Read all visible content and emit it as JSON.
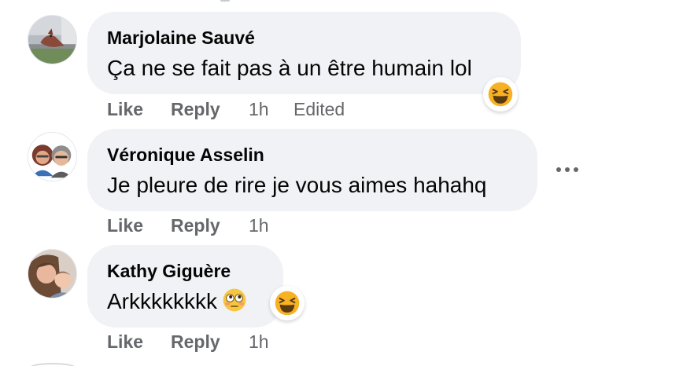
{
  "comments": [
    {
      "author": "Marjolaine Sauvé",
      "text": "Ça ne se fait pas à un être humain lol",
      "avatar": "bird-photo-avatar",
      "reaction": "laughing-face-icon",
      "actions": {
        "like": "Like",
        "reply": "Reply",
        "time": "1h",
        "edited": "Edited"
      }
    },
    {
      "author": "Véronique Asselin",
      "text": "Je pleure de rire je vous aimes hahahq",
      "avatar": "couple-photo-avatar",
      "actions": {
        "like": "Like",
        "reply": "Reply",
        "time": "1h"
      }
    },
    {
      "author": "Kathy Giguère",
      "text": "Arkkkkkkkk",
      "avatar": "selfie-photo-avatar",
      "inline_emoji": "flushed-face-icon",
      "reaction": "laughing-face-icon",
      "actions": {
        "like": "Like",
        "reply": "Reply",
        "time": "1h"
      }
    }
  ],
  "more_icon": "more-options-icon",
  "colors": {
    "bubble": "#f0f2f5",
    "meta_text": "#65676b",
    "body_text": "#050505",
    "emoji_yellow": "#f7b125"
  }
}
